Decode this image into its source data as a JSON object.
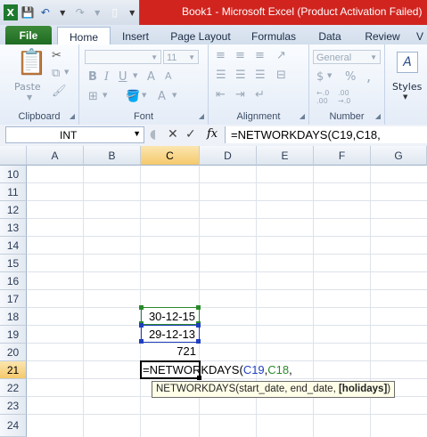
{
  "window": {
    "title": "Book1  -  Microsoft Excel (Product Activation Failed)"
  },
  "tabs": [
    "File",
    "Home",
    "Insert",
    "Page Layout",
    "Formulas",
    "Data",
    "Review",
    "V"
  ],
  "ribbon": {
    "clipboard": {
      "label": "Clipboard",
      "paste": "Paste"
    },
    "font": {
      "label": "Font",
      "size": "11"
    },
    "alignment": {
      "label": "Alignment"
    },
    "number": {
      "label": "Number",
      "format": "General",
      "currency": "$",
      "percent": "%",
      "comma": ",",
      "inc_decimal": "←.0\n.00",
      "dec_decimal": ".00\n→.0"
    },
    "styles": {
      "label": "Styles"
    }
  },
  "formula_bar": {
    "name_box": "INT",
    "formula": "=NETWORKDAYS(C19,C18,"
  },
  "columns": [
    "A",
    "B",
    "C",
    "D",
    "E",
    "F",
    "G"
  ],
  "rows": [
    "10",
    "11",
    "12",
    "13",
    "14",
    "15",
    "16",
    "17",
    "18",
    "19",
    "20",
    "21",
    "22",
    "23",
    "24"
  ],
  "cells": {
    "C18": "30-12-15",
    "C19": "29-12-13",
    "C20": "721",
    "C21_prefix": "=NETWORKDAYS(",
    "C21_ref1": "C19",
    "C21_sep": ",",
    "C21_ref2": "C18",
    "C21_suffix": ","
  },
  "tooltip": {
    "text": "NETWORKDAYS(start_date, end_date, ",
    "bold": "[holidays]",
    "close": ")"
  }
}
